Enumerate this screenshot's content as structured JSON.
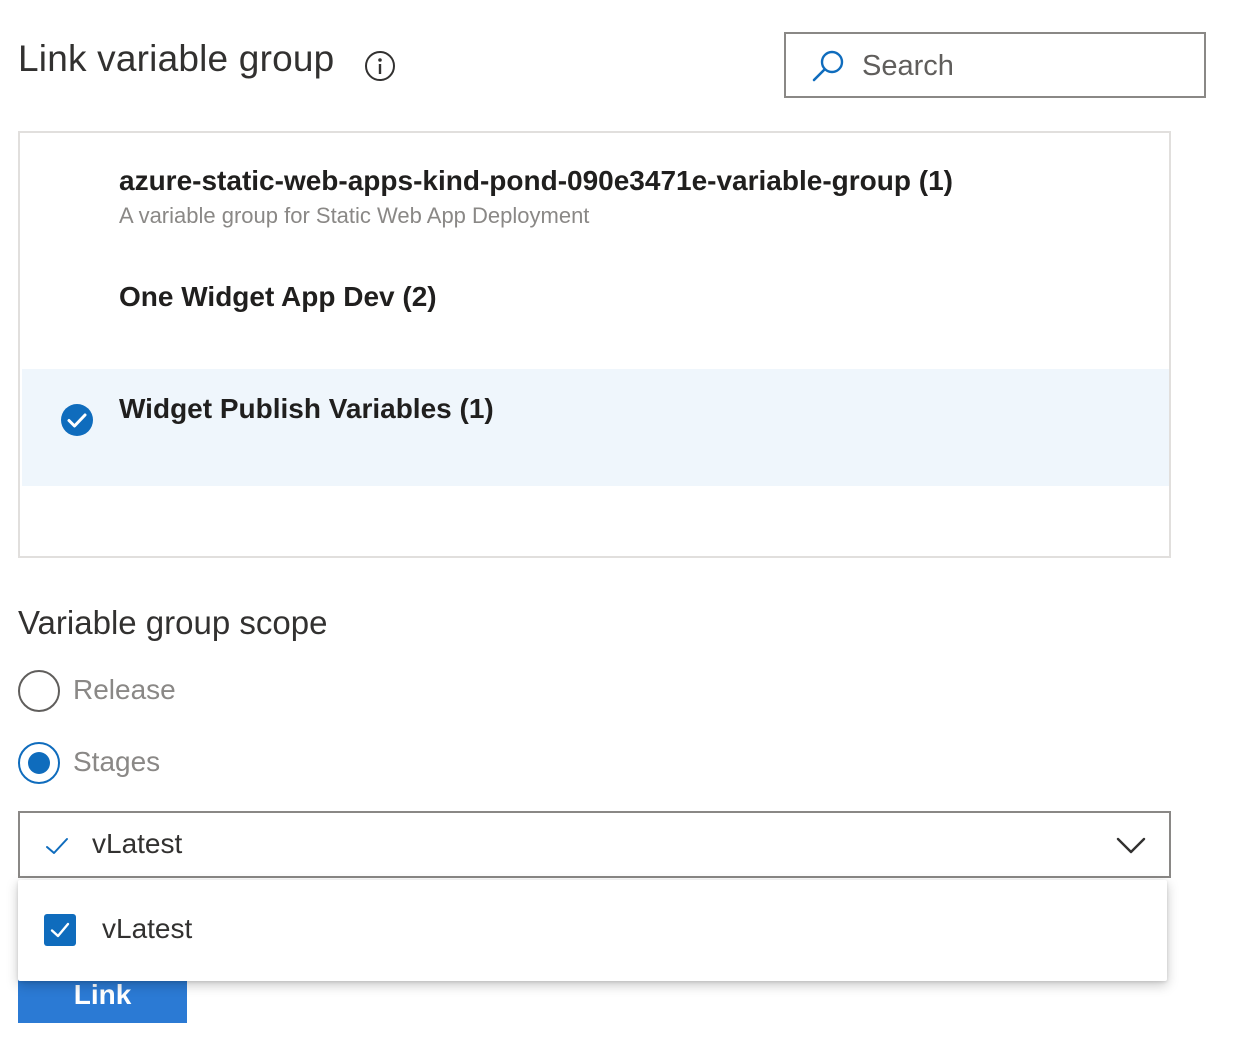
{
  "header": {
    "title": "Link variable group",
    "info_icon": "info-icon"
  },
  "search": {
    "placeholder": "Search",
    "value": "",
    "icon": "search-icon"
  },
  "variable_groups": [
    {
      "name": "azure-static-web-apps-kind-pond-090e3471e-variable-group (1)",
      "description": "A variable group for Static Web App Deployment",
      "selected": false
    },
    {
      "name": "One Widget App Dev (2)",
      "description": "",
      "selected": false
    },
    {
      "name": "Widget Publish Variables (1)",
      "description": "",
      "selected": true
    }
  ],
  "scope": {
    "title": "Variable group scope",
    "options": [
      {
        "label": "Release",
        "checked": false
      },
      {
        "label": "Stages",
        "checked": true
      }
    ]
  },
  "stage_dropdown": {
    "selected_value": "vLatest",
    "options": [
      {
        "label": "vLatest",
        "checked": true
      }
    ]
  },
  "actions": {
    "link_label": "Link"
  },
  "colors": {
    "accent": "#0f6cbd",
    "selected_row": "#eff6fc",
    "button": "#2b7ad4"
  }
}
